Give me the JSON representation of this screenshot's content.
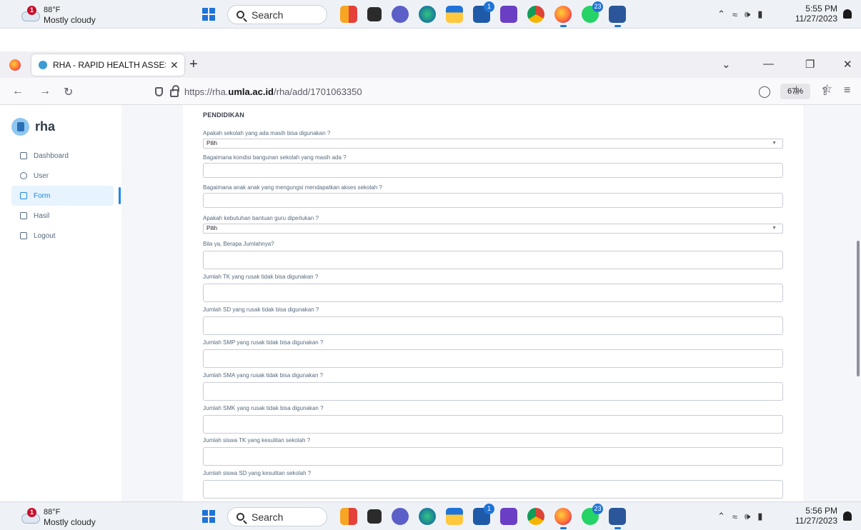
{
  "taskbar": {
    "weather_temp": "88°F",
    "weather_cond": "Mostly cloudy",
    "weather_badge": "1",
    "search_label": "Search",
    "badge_teams": "1",
    "badge_whatsapp": "23",
    "time_top": "5:55 PM",
    "date_top": "11/27/2023",
    "time_bottom": "5:56 PM",
    "date_bottom": "11/27/2023"
  },
  "browser": {
    "tab_title": "RHA - RAPID HEALTH ASSESSM",
    "url_prefix": "https://rha.",
    "url_domain": "umla.ac.id",
    "url_path": "/rha/add/1701063350",
    "zoom": "67%"
  },
  "sidebar": {
    "brand": "rha",
    "items": [
      {
        "label": "Dashboard"
      },
      {
        "label": "User"
      },
      {
        "label": "Form"
      },
      {
        "label": "Hasil"
      },
      {
        "label": "Logout"
      }
    ]
  },
  "form": {
    "section": "PENDIDIKAN",
    "select_value": "Pilih",
    "fields": [
      {
        "label": "Apakah sekolah yang ada masih bisa digunakan ?"
      },
      {
        "label": "Bagaimana kondisi bangunan sekolah yang masih ada ?"
      },
      {
        "label": "Bagaimana anak anak yang mengungsi mendapatkan akses sekolah ?"
      },
      {
        "label": "Apakah kebutuhan bantuan guru diperlukan ?"
      },
      {
        "label": "Bila ya, Berapa Jumlahnya?"
      },
      {
        "label": "Jumlah TK yang rusak tidak bisa digunakan ?"
      },
      {
        "label": "Jumlah SD yang rusak tidak bisa digunakan ?"
      },
      {
        "label": "Jumlah SMP yang rusak tidak bisa digunakan ?"
      },
      {
        "label": "Jumlah SMA yang rusak tidak bisa digunakan ?"
      },
      {
        "label": "Jumlah SMK yang rusak tidak bisa digunakan ?"
      },
      {
        "label": "Jumlah siswa TK yang kesulitan sekolah ?"
      },
      {
        "label": "Jumlah siswa SD yang kesulitan sekolah ?"
      }
    ]
  },
  "colors": {
    "accent": "#1e88e5",
    "active_bg": "#e7f3fd",
    "taskbar_bg": "#eef2f7"
  },
  "icons": [
    "windows-logo-icon",
    "search-icon",
    "firefox-icon",
    "shield-icon",
    "lock-icon",
    "star-icon",
    "bell-icon",
    "wifi-icon",
    "volume-icon",
    "battery-icon"
  ]
}
